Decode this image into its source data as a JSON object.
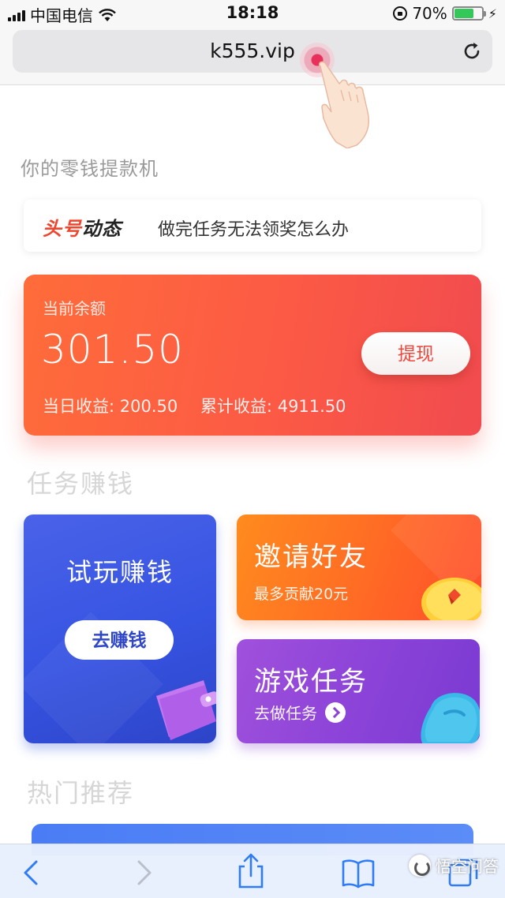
{
  "status_bar": {
    "carrier": "中国电信",
    "time": "18:18",
    "battery_percent": "70%",
    "battery_level": 0.7
  },
  "browser": {
    "url": "k555.vip"
  },
  "page": {
    "heading": "你的零钱提款机",
    "news": {
      "logo_part1": "头号",
      "logo_part2": "动态",
      "text": "做完任务无法领奖怎么办"
    },
    "balance": {
      "label": "当前余额",
      "amount": "301.50",
      "withdraw_label": "提现",
      "today_label": "当日收益:",
      "today_value": "200.50",
      "total_label": "累计收益:",
      "total_value": "4911.50"
    },
    "tasks_section_title": "任务赚钱",
    "trial": {
      "title": "试玩赚钱",
      "button": "去赚钱"
    },
    "invite": {
      "title": "邀请好友",
      "subtitle": "最多贡献20元"
    },
    "game": {
      "title": "游戏任务",
      "subtitle": "去做任务"
    },
    "hot_section_title": "热门推荐"
  },
  "watermark": {
    "text": "悟空问答"
  },
  "colors": {
    "balance_gradient_start": "#ff6c3a",
    "balance_gradient_end": "#f14b4f",
    "trial_card": "#3654e2",
    "invite_card": "#ff6d24",
    "game_card": "#8c43d8",
    "ios_blue": "#2f7cf6"
  },
  "icons": {
    "toolbar": [
      "chevron-left-icon",
      "chevron-right-icon",
      "share-icon",
      "book-icon",
      "tabs-icon"
    ]
  }
}
